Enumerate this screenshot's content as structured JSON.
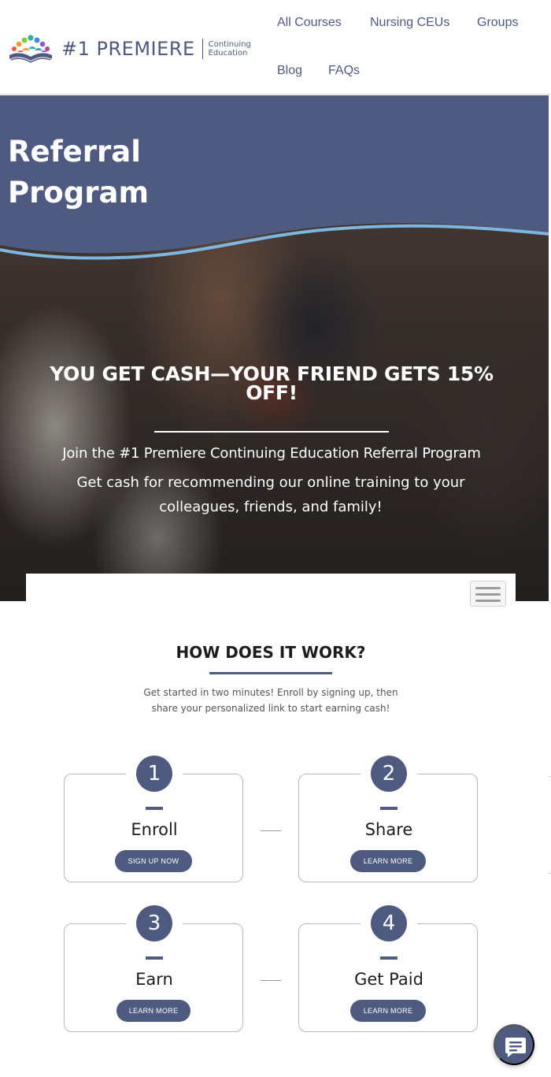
{
  "header": {
    "logo": {
      "name": "#1 PREMIERE",
      "sub_line1": "Continuing",
      "sub_line2": "Education",
      "icon": "book-with-people-icon"
    },
    "nav": [
      {
        "label": "All Courses"
      },
      {
        "label": "Nursing CEUs"
      },
      {
        "label": "Groups"
      },
      {
        "label": "Blog"
      },
      {
        "label": "FAQs"
      }
    ]
  },
  "hero": {
    "title": "Referral Program",
    "headline": "YOU GET CASH—YOUR FRIEND GETS 15% OFF!",
    "subheadline": "Join the #1 Premiere Continuing Education Referral Program",
    "description": "Get cash for recommending our online training to your colleagues, friends, and family!"
  },
  "menu_button": {
    "icon": "hamburger-menu-icon"
  },
  "how": {
    "title": "HOW DOES IT WORK?",
    "description": "Get started in two minutes! Enroll by signing up, then share your personalized link to start earning cash!",
    "steps": [
      {
        "number": "1",
        "name": "Enroll",
        "button": "SIGN UP NOW"
      },
      {
        "number": "2",
        "name": "Share",
        "button": "LEARN MORE"
      },
      {
        "number": "3",
        "name": "Earn",
        "button": "LEARN MORE"
      },
      {
        "number": "4",
        "name": "Get Paid",
        "button": "LEARN MORE"
      }
    ]
  },
  "chat": {
    "icon": "chat-bubble-icon"
  },
  "colors": {
    "brand": "#4e5a80",
    "wave_accent": "#7eb6df",
    "text_dark": "#1d1d1d"
  }
}
